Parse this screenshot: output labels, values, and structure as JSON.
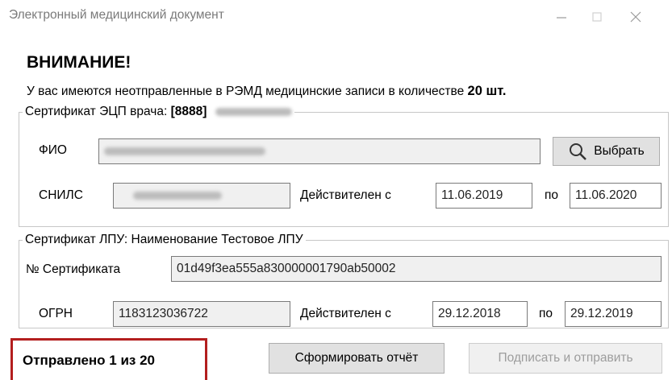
{
  "window": {
    "title": "Электронный медицинский документ"
  },
  "notice": {
    "heading": "ВНИМАНИЕ!",
    "text": "У вас имеются неотправленные в РЭМД медицинские записи в количестве",
    "count": "20 шт."
  },
  "doctor_cert": {
    "legend_prefix": "Сертификат ЭЦП врача:",
    "code": "[8888]",
    "fio_label": "ФИО",
    "snils_label": "СНИЛС",
    "valid_from_label": "Действителен с",
    "valid_from": "11.06.2019",
    "to_label": "по",
    "valid_to": "11.06.2020",
    "select_button": "Выбрать"
  },
  "lpu_cert": {
    "legend": "Сертификат ЛПУ: Наименование Тестовое ЛПУ",
    "number_label": "№ Сертификата",
    "number": "01d49f3ea555a830000001790ab50002",
    "ogrn_label": "ОГРН",
    "ogrn": "1183123036722",
    "valid_from_label": "Действителен с",
    "valid_from": "29.12.2018",
    "to_label": "по",
    "valid_to": "29.12.2019"
  },
  "footer": {
    "status": "Отправлено 1 из 20",
    "report_button": "Сформировать отчёт",
    "sign_button": "Подписать и отправить"
  },
  "icons": {
    "minimize": "minimize-icon",
    "maximize": "maximize-icon",
    "close": "close-icon",
    "search": "search-icon"
  },
  "colors": {
    "status_border": "#b31e1e",
    "readonly_field": "#f0f0f0",
    "disabled_text": "#9d9d9d"
  }
}
